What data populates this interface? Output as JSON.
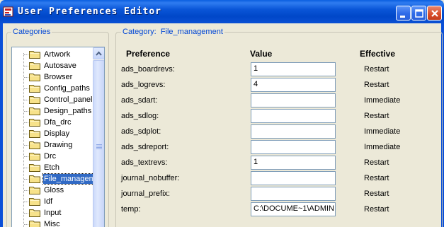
{
  "window": {
    "title": "User Preferences Editor",
    "icons": {
      "app": "app-icon",
      "minimize": "minimize-icon",
      "maximize": "maximize-icon",
      "close": "close-icon"
    }
  },
  "categories": {
    "legend": "Categories",
    "selected": "File_management",
    "items": [
      {
        "label": "Artwork"
      },
      {
        "label": "Autosave"
      },
      {
        "label": "Browser"
      },
      {
        "label": "Config_paths"
      },
      {
        "label": "Control_panel"
      },
      {
        "label": "Design_paths"
      },
      {
        "label": "Dfa_drc"
      },
      {
        "label": "Display"
      },
      {
        "label": "Drawing"
      },
      {
        "label": "Drc"
      },
      {
        "label": "Etch"
      },
      {
        "label": "File_managem"
      },
      {
        "label": "Gloss"
      },
      {
        "label": "Idf"
      },
      {
        "label": "Input"
      },
      {
        "label": "Misc"
      }
    ]
  },
  "category_panel": {
    "prefix": "Category:",
    "name": "File_management"
  },
  "table": {
    "headers": {
      "preference": "Preference",
      "value": "Value",
      "effective": "Effective"
    },
    "rows": [
      {
        "name": "ads_boardrevs:",
        "value": "1",
        "effective": "Restart"
      },
      {
        "name": "ads_logrevs:",
        "value": "4",
        "effective": "Restart"
      },
      {
        "name": "ads_sdart:",
        "value": "",
        "effective": "Immediate"
      },
      {
        "name": "ads_sdlog:",
        "value": "",
        "effective": "Restart"
      },
      {
        "name": "ads_sdplot:",
        "value": "",
        "effective": "Immediate"
      },
      {
        "name": "ads_sdreport:",
        "value": "",
        "effective": "Immediate"
      },
      {
        "name": "ads_textrevs:",
        "value": "1",
        "effective": "Restart"
      },
      {
        "name": "journal_nobuffer:",
        "value": "",
        "effective": "Restart"
      },
      {
        "name": "journal_prefix:",
        "value": "",
        "effective": "Restart"
      },
      {
        "name": "temp:",
        "value": "C:\\DOCUME~1\\ADMIN",
        "effective": "Restart"
      }
    ]
  },
  "colors": {
    "titlebar": "#0a56d8",
    "legend_text": "#0046d5",
    "selection": "#316ac5",
    "close_button": "#d84b28"
  }
}
